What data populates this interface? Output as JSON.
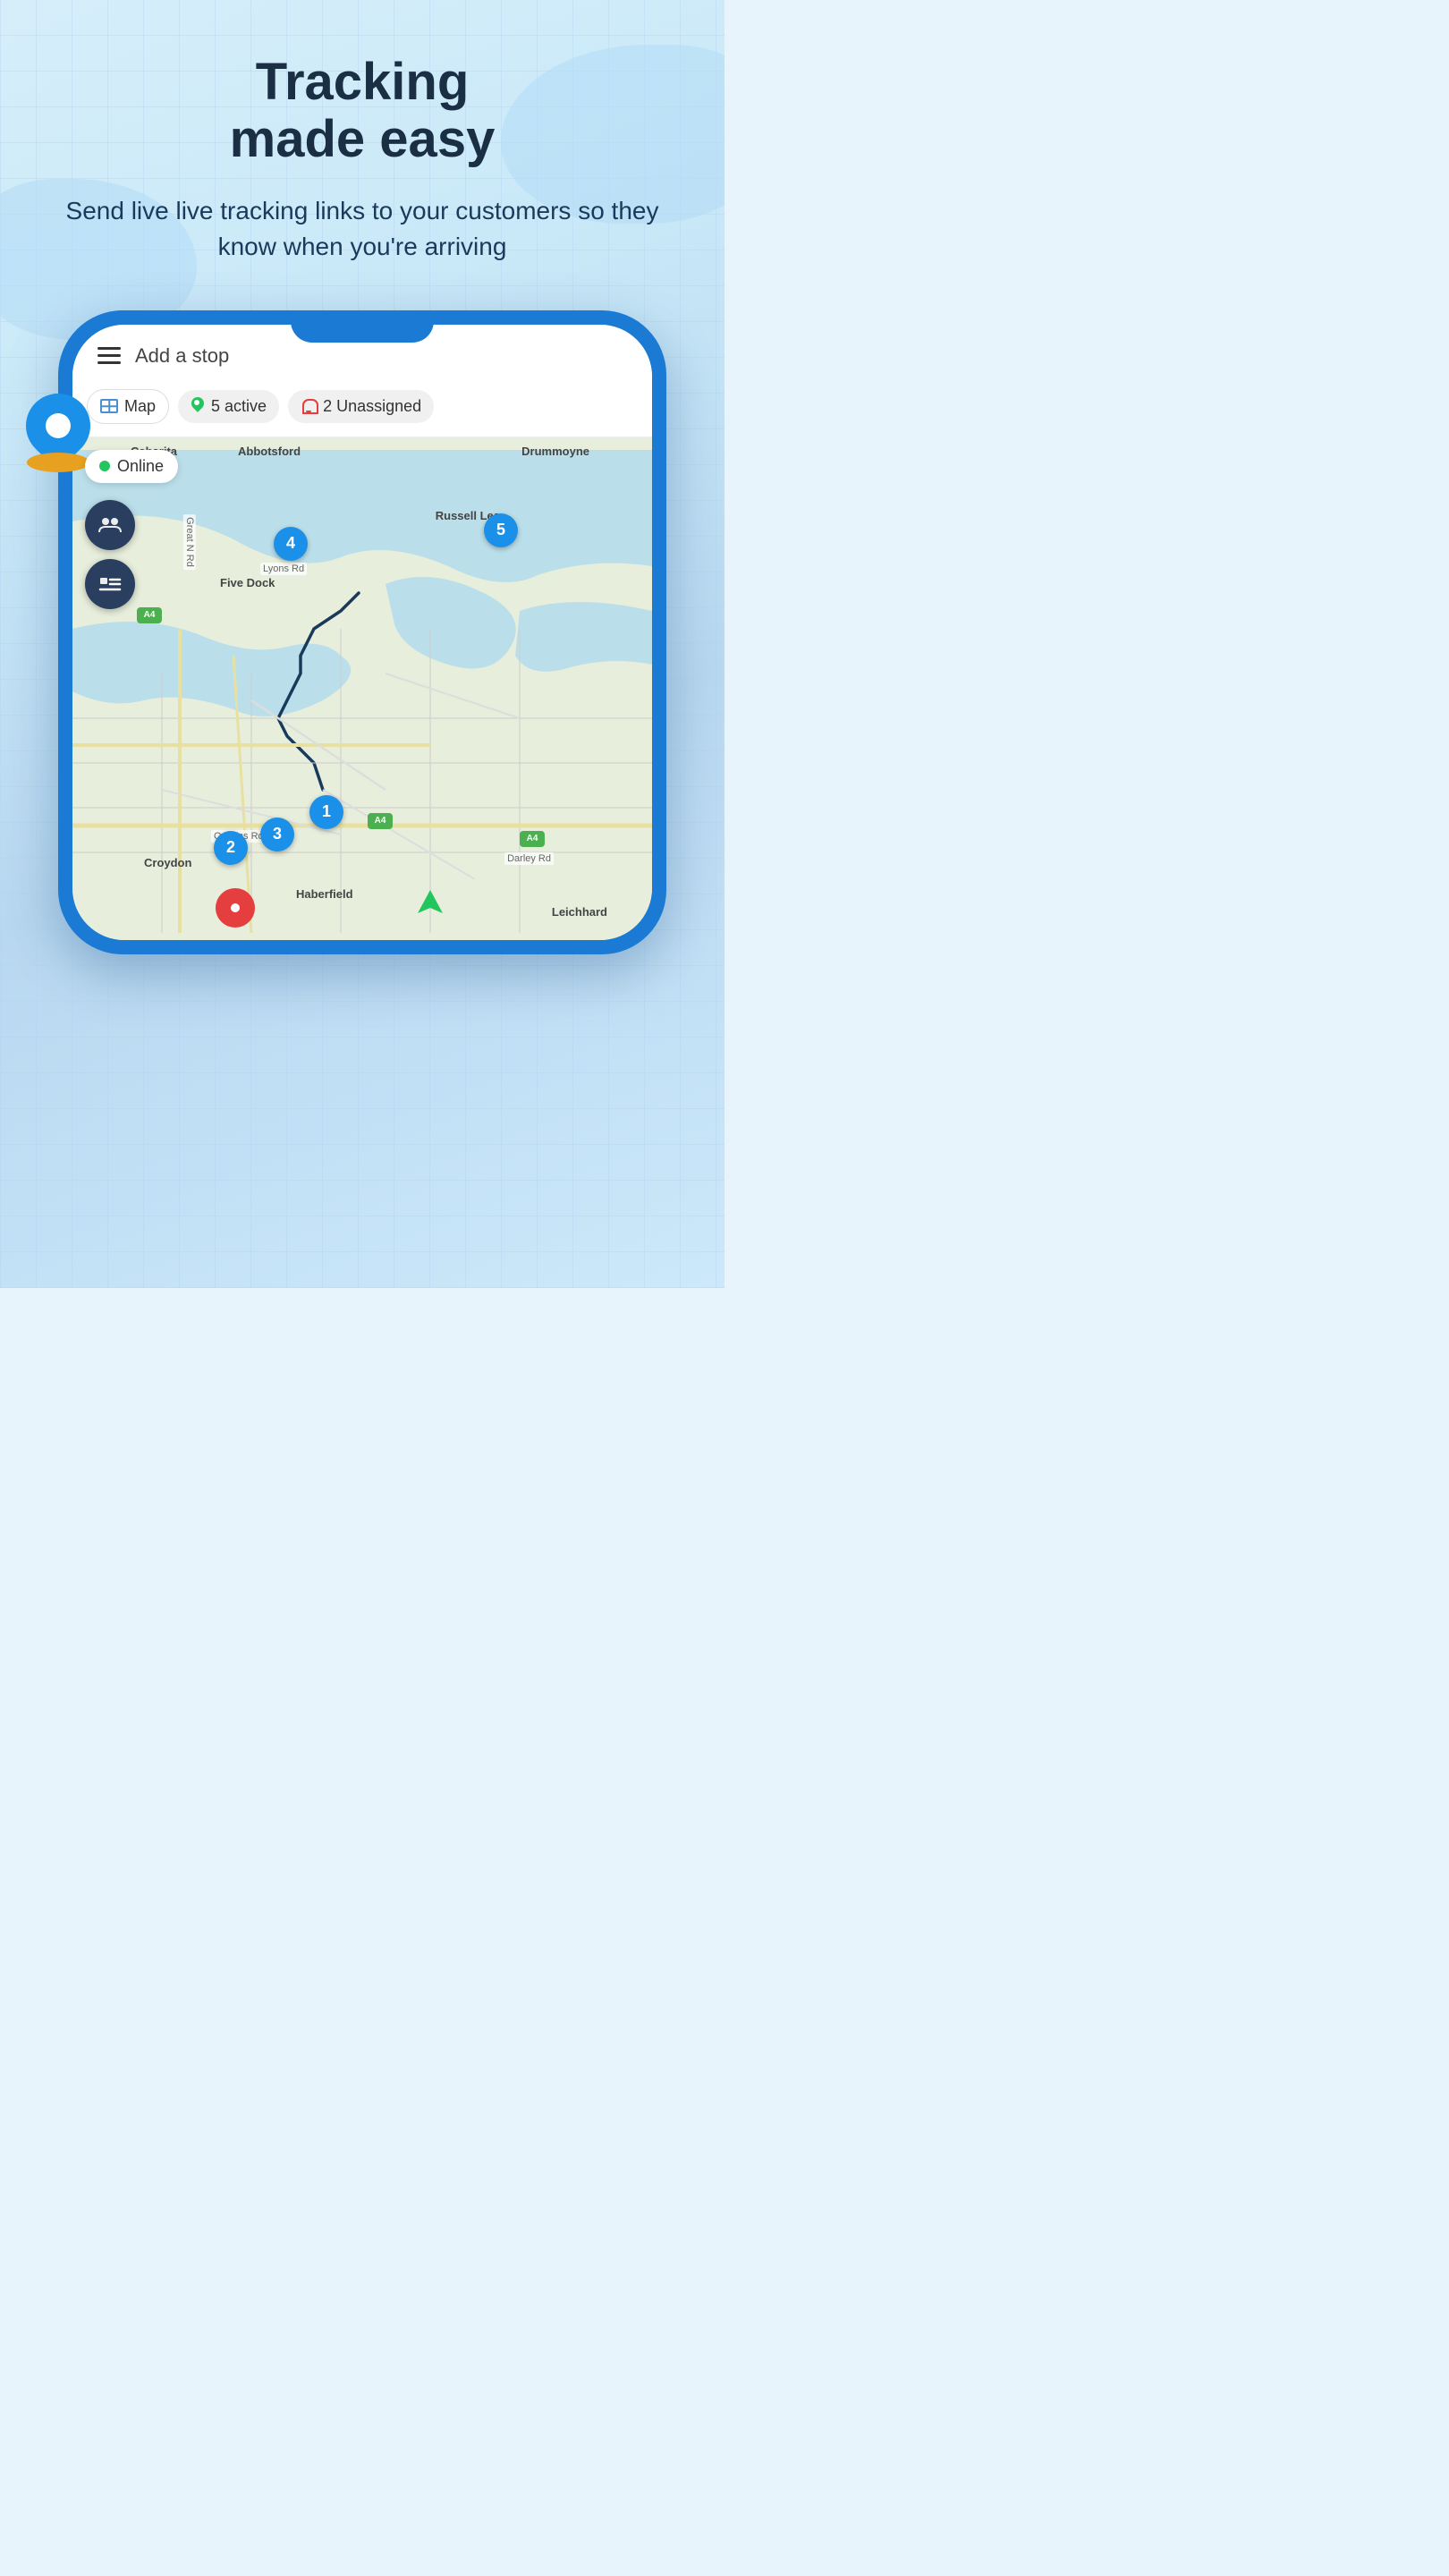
{
  "hero": {
    "headline_line1": "Tracking",
    "headline_line2": "made easy",
    "subtitle": "Send live live tracking links to your customers so they know when you're arriving"
  },
  "phone": {
    "topbar": {
      "add_stop_label": "Add a stop"
    },
    "tabs": [
      {
        "id": "map",
        "label": "Map",
        "icon": "map-icon"
      },
      {
        "id": "active",
        "label": "5 active",
        "icon": "location-icon"
      },
      {
        "id": "unassigned",
        "label": "2 Unassigned",
        "icon": "bell-icon"
      }
    ],
    "map": {
      "online_label": "Online",
      "route_pins": [
        {
          "number": "1",
          "position": "pin1"
        },
        {
          "number": "2",
          "position": "pin2"
        },
        {
          "number": "3",
          "position": "pin3"
        },
        {
          "number": "4",
          "position": "pin4"
        },
        {
          "number": "5",
          "position": "pin5"
        }
      ],
      "area_labels": [
        "Cabarita",
        "Abbotsford",
        "Drummoyne",
        "Russell Lea",
        "Five Dock",
        "Croydon",
        "Haberfield",
        "Leichhard"
      ],
      "road_labels": [
        "Great N Rd",
        "Lyons Rd",
        "Queens Rd",
        "Darley Rd"
      ],
      "highway_badges": [
        "A4",
        "A4",
        "A4"
      ]
    }
  },
  "colors": {
    "primary_blue": "#1a7ad4",
    "dark_text": "#1a2e44",
    "subtitle_text": "#1a3a5c",
    "online_green": "#22c55e",
    "alert_red": "#e53e3e",
    "route_blue": "#1a90e8",
    "map_bg": "#e8eedc"
  }
}
